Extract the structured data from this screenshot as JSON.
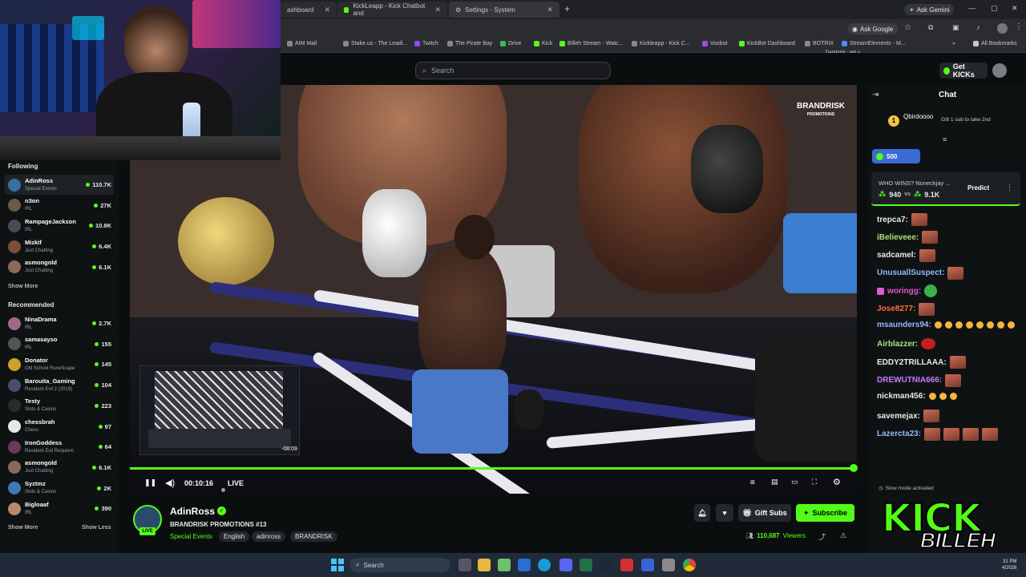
{
  "browser": {
    "tabs": [
      {
        "title": "ashboard"
      },
      {
        "title": "KickLeapp - Kick Chatbot and"
      },
      {
        "title": "Settings - System"
      }
    ],
    "ask_gemini": "Ask Gemini",
    "ask_google": "Ask Google",
    "bookmarks": [
      "AIM Mail",
      "Stake.us - The Leadi...",
      "Twitch",
      "The Pirate Bay",
      "Drive",
      "Kick",
      "Billeh Stream - Watc...",
      "Kickleapp - Kick C...",
      "Voxbot",
      "KickBot Dashboard",
      "BOTRIX",
      "StreamElements - M..."
    ],
    "all_bookmarks": "All Bookmarks",
    "popup_text": "Darxtorm : got u"
  },
  "header": {
    "search_placeholder": "Search",
    "get_kicks": "Get KICKs"
  },
  "sidebar": {
    "following_title": "Following",
    "following": [
      {
        "name": "AdinRoss",
        "category": "Special Events",
        "viewers": "110.7K",
        "color": "#3a6ea5"
      },
      {
        "name": "n3on",
        "category": "IRL",
        "viewers": "27K",
        "color": "#6b5a44"
      },
      {
        "name": "RampageJackson",
        "category": "IRL",
        "viewers": "10.8K",
        "color": "#4a4a55"
      },
      {
        "name": "Mizkif",
        "category": "Just Chatting",
        "viewers": "6.4K",
        "color": "#7a4e3a"
      },
      {
        "name": "asmongold",
        "category": "Just Chatting",
        "viewers": "6.1K",
        "color": "#8a6a5a"
      }
    ],
    "show_more_following": "Show More",
    "recommended_title": "Recommended",
    "recommended": [
      {
        "name": "NinaDrama",
        "category": "IRL",
        "viewers": "2.7K",
        "color": "#a06b8a"
      },
      {
        "name": "samasayso",
        "category": "IRL",
        "viewers": "155",
        "color": "#555"
      },
      {
        "name": "Donator",
        "category": "Old School RuneScape",
        "viewers": "145",
        "color": "#c9a227"
      },
      {
        "name": "Barouita_Gaming",
        "category": "Resident Evil 2 (2019)",
        "viewers": "104",
        "color": "#44506a"
      },
      {
        "name": "Testy",
        "category": "Slots & Casino",
        "viewers": "223",
        "color": "#2a2a2a"
      },
      {
        "name": "chessbrah",
        "category": "Chess",
        "viewers": "97",
        "color": "#e8e8e8"
      },
      {
        "name": "IronGoddess",
        "category": "Resident Evil Requiem",
        "viewers": "64",
        "color": "#6a3a5a"
      },
      {
        "name": "asmongold",
        "category": "Just Chatting",
        "viewers": "6.1K",
        "color": "#8a6a5a"
      },
      {
        "name": "Syztmz",
        "category": "Slots & Casino",
        "viewers": "2K",
        "color": "#3a7ab5"
      },
      {
        "name": "Bigloaaf",
        "category": "IRL",
        "viewers": "390",
        "color": "#b58a6a"
      }
    ],
    "show_more": "Show More",
    "show_less": "Show Less"
  },
  "video": {
    "brand_logo": "BRANDRISK",
    "brand_sub": "PROMOTIONS",
    "preview_time": "-08:09",
    "time": "00:10:16",
    "live_label": "LIVE",
    "progress": 1.0
  },
  "stream": {
    "channel": "AdinRoss",
    "live_badge": "LIVE",
    "title": "BRANDRISK PROMOTIONS #13",
    "category": "Special Events",
    "tags": [
      "English",
      "adinross",
      "BRANDRISK"
    ],
    "viewers_count": "110,687",
    "viewers_label": "Viewers",
    "gift_subs": "Gift Subs",
    "subscribe": "Subscribe"
  },
  "chat": {
    "title": "Chat",
    "pinned_user": "Qbirdoooo",
    "pinned_rank": "1",
    "pinned_text": "Gift 1 sub to take 2nd",
    "points": "500",
    "prediction_question": "WHO WINS? Noneckjay ...",
    "prediction_left": "940",
    "prediction_vs": "vs",
    "prediction_right": "9.1K",
    "predict_button": "Predict",
    "messages": [
      {
        "user": "trepca7:",
        "color": "#e8e8e8",
        "emotes": 1,
        "emojis": 0
      },
      {
        "user": "iBelieveee:",
        "color": "#a6e37a",
        "emotes": 1,
        "emojis": 0
      },
      {
        "user": "sadcamel:",
        "color": "#e8e8e8",
        "emotes": 1,
        "emojis": 0
      },
      {
        "user": "UnusuallSuspect:",
        "color": "#8fb9ff",
        "emotes": 1,
        "emojis": 0
      },
      {
        "user": "woringg:",
        "color": "#e05ad0",
        "emotes": 0,
        "emojis": 0,
        "badge": true,
        "green_emote": true
      },
      {
        "user": "Jose8277:",
        "color": "#ff6a3d",
        "emotes": 1,
        "emojis": 0
      },
      {
        "user": "msaunders94:",
        "color": "#8fb9ff",
        "emotes": 0,
        "emojis": 8
      },
      {
        "user": "Airblazzer:",
        "color": "#a6e37a",
        "emotes": 0,
        "emojis": 0,
        "heart": true
      },
      {
        "user": "EDDY2TRILLAAA:",
        "color": "#e8e8e8",
        "emotes": 1,
        "emojis": 0
      },
      {
        "user": "DREWUTNIA666:",
        "color": "#c87aff",
        "emotes": 1,
        "emojis": 0
      },
      {
        "user": "nickman456:",
        "color": "#e8e8e8",
        "emotes": 0,
        "emojis": 3
      },
      {
        "user": "savemejax:",
        "color": "#e8e8e8",
        "emotes": 1,
        "emojis": 0
      },
      {
        "user": "Lazercta23:",
        "color": "#8fb9ff",
        "emotes": 4,
        "emojis": 0
      }
    ],
    "slow_mode": "Slow mode activated"
  },
  "overlay": {
    "brand": "KICK",
    "name": "BILLEH"
  },
  "taskbar": {
    "search_placeholder": "Search",
    "clock_time": "31 PM",
    "clock_date": "4/2026"
  }
}
